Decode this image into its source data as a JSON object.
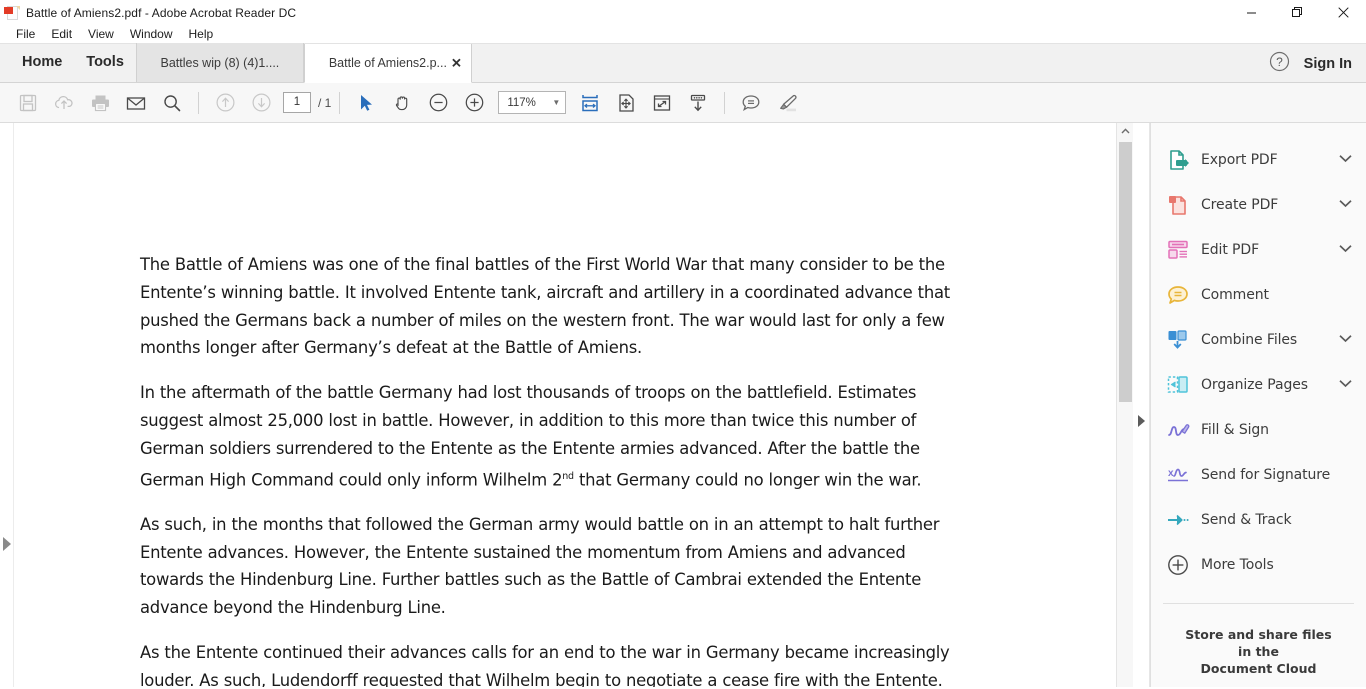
{
  "titlebar": {
    "title": "Battle of Amiens2.pdf - Adobe Acrobat Reader DC",
    "app_icon": "acrobat-pdf-icon",
    "minimize": "—",
    "maximize": "❐",
    "close": "✕"
  },
  "menubar": {
    "items": [
      {
        "label": "File"
      },
      {
        "label": "Edit"
      },
      {
        "label": "View"
      },
      {
        "label": "Window"
      },
      {
        "label": "Help"
      }
    ]
  },
  "tabbar": {
    "home_label": "Home",
    "tools_label": "Tools",
    "tabs": [
      {
        "label": "Battles wip (8) (4)1....",
        "active": false,
        "closable": false
      },
      {
        "label": "Battle of Amiens2.p...",
        "active": true,
        "closable": true,
        "close_glyph": "✕"
      }
    ],
    "help_icon": "question-mark-circle-icon",
    "sign_in_label": "Sign In"
  },
  "toolbar": {
    "buttons": [
      {
        "name": "save-file-icon",
        "disabled": true
      },
      {
        "name": "save-to-cloud-icon",
        "disabled": true
      },
      {
        "name": "print-icon",
        "disabled": true
      },
      {
        "name": "email-icon",
        "disabled": false
      },
      {
        "name": "search-icon",
        "disabled": false
      },
      {
        "name": "previous-page-icon",
        "disabled": true
      },
      {
        "name": "next-page-icon",
        "disabled": true
      }
    ],
    "page_number": "1",
    "page_total": "/ 1",
    "select_tool_icon": "cursor-arrow-icon",
    "hand_tool_icon": "hand-icon",
    "zoom_out_icon": "zoom-out-icon",
    "zoom_in_icon": "zoom-in-icon",
    "zoom_value": "117%",
    "zoom_dropdown_glyph": "▼",
    "fit_width_icon": "fit-page-width-icon",
    "pan_page_icon": "pan-zoom-page-icon",
    "fullscreen_icon": "fullscreen-read-mode-icon",
    "scroll_mode_icon": "scroll-down-icon",
    "comment_icon": "comment-bubble-icon",
    "highlight_icon": "highlighter-pen-icon"
  },
  "navigation": {
    "left_pane_expand_icon": "expand-navigation-pane-icon",
    "right_pane_collapse_icon": "collapse-right-pane-icon",
    "scroll_up_icon": "scroll-up-arrow-icon"
  },
  "document": {
    "paragraphs": [
      "The Battle of Amiens was one of the final battles of the First World War that many consider to be the Entente’s winning battle. It involved Entente tank, aircraft and artillery in a coordinated advance that pushed the Germans back a number of miles on the western front. The war would last for only a few months longer after Germany’s defeat at the Battle of Amiens.",
      "In the aftermath of the battle Germany had lost thousands of troops on the battlefield. Estimates suggest almost 25,000 lost in battle. However, in addition to this more than twice this number of German soldiers surrendered to the Entente as the Entente armies advanced. After the battle the German High Command could only inform Wilhelm 2",
      "As such, in the months that followed the German army would battle on in an attempt to halt further Entente advances. However, the Entente sustained the momentum from Amiens and advanced towards the Hindenburg Line. Further battles such as the Battle of Cambrai extended the Entente advance beyond the Hindenburg Line.",
      "As the Entente continued their advances calls for an end to the war in Germany became increasingly louder. As such, Ludendorff requested that Wilhelm begin to negotiate a cease fire with the Entente."
    ],
    "para2_superscript": "nd",
    "para2_tail": " that Germany could no longer win the war."
  },
  "rightpanel": {
    "tools": [
      {
        "label": "Export PDF",
        "icon": "export-pdf-icon",
        "color": "#2f9e8f",
        "chevron": "⌄"
      },
      {
        "label": "Create PDF",
        "icon": "create-pdf-icon",
        "color": "#e8776d",
        "chevron": "⌄"
      },
      {
        "label": "Edit PDF",
        "icon": "edit-pdf-icon",
        "color": "#e371b8",
        "chevron": "⌄"
      },
      {
        "label": "Comment",
        "icon": "comment-icon",
        "color": "#e8b53a",
        "chevron": ""
      },
      {
        "label": "Combine Files",
        "icon": "combine-files-icon",
        "color": "#3a8fd4",
        "chevron": "⌄"
      },
      {
        "label": "Organize Pages",
        "icon": "organize-pages-icon",
        "color": "#4fc3d9",
        "chevron": "⌄"
      },
      {
        "label": "Fill & Sign",
        "icon": "fill-and-sign-icon",
        "color": "#7b72d6",
        "chevron": ""
      },
      {
        "label": "Send for Signature",
        "icon": "send-for-signature-icon",
        "color": "#7b72d6",
        "chevron": ""
      },
      {
        "label": "Send & Track",
        "icon": "send-and-track-icon",
        "color": "#35a8bd",
        "chevron": ""
      },
      {
        "label": "More Tools",
        "icon": "more-tools-plus-icon",
        "color": "#4a4a4a",
        "chevron": ""
      }
    ],
    "cloud_promo_line1": "Store and share files in the",
    "cloud_promo_line2": "Document Cloud"
  }
}
